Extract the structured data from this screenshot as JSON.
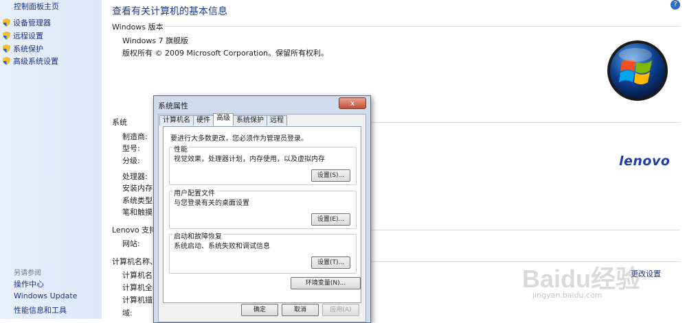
{
  "sidebar": {
    "home": "控制面板主页",
    "items": [
      {
        "label": "设备管理器"
      },
      {
        "label": "远程设置"
      },
      {
        "label": "系统保护"
      },
      {
        "label": "高级系统设置"
      }
    ],
    "see_also_title": "另请参阅",
    "see_also": [
      "操作中心",
      "Windows Update",
      "性能信息和工具"
    ]
  },
  "main": {
    "heading": "查看有关计算机的基本信息",
    "edition_section": "Windows 版本",
    "edition": "Windows 7 旗舰版",
    "copyright": "版权所有 © 2009 Microsoft Corporation。保留所有权利。",
    "system_section": "系统",
    "system_rows": [
      "制造商:",
      "型号:",
      "分级:",
      "处理器:",
      "安装内存(R",
      "系统类型:",
      "笔和触摸:"
    ],
    "support_section": "Lenovo 支持",
    "support_rows": [
      "网站:"
    ],
    "name_section": "计算机名称、域",
    "name_rows": [
      "计算机名:",
      "计算机全名",
      "计算机描述",
      "域:"
    ],
    "change_link": "更改设置",
    "brand": "lenovo"
  },
  "dialog": {
    "title": "系统属性",
    "close": "x",
    "tabs": [
      "计算机名",
      "硬件",
      "高级",
      "系统保护",
      "远程"
    ],
    "note": "要进行大多数更改，您必须作为管理员登录。",
    "groups": [
      {
        "title": "性能",
        "desc": "视觉效果，处理器计划，内存使用，以及虚拟内存",
        "button": "设置(S)..."
      },
      {
        "title": "用户配置文件",
        "desc": "与您登录有关的桌面设置",
        "button": "设置(E)..."
      },
      {
        "title": "启动和故障恢复",
        "desc": "系统启动、系统失败和调试信息",
        "button": "设置(T)..."
      }
    ],
    "env_button": "环境变量(N)...",
    "ok": "确定",
    "cancel": "取消",
    "apply": "应用(A)"
  },
  "watermark": {
    "text": "Baidu经验",
    "url": "jingyan.baidu.com"
  },
  "colors": {
    "link": "#1e3287",
    "heading": "#1e3c8c",
    "accent": "#1b3fa6"
  }
}
